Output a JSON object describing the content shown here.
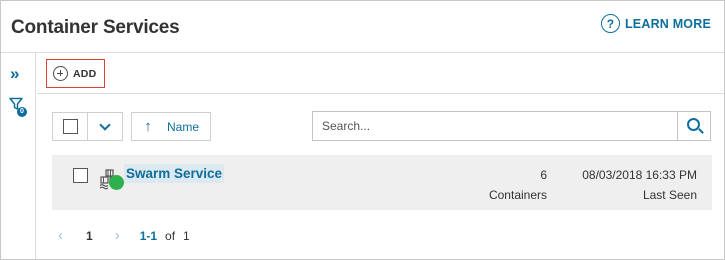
{
  "header": {
    "title": "Container Services",
    "help_glyph": "?",
    "learn_more": "LEARN MORE"
  },
  "sidebar": {
    "expand_glyph": "»",
    "filter_count": "0"
  },
  "toolbar": {
    "add_label": "ADD"
  },
  "list_controls": {
    "sort_arrow": "↑",
    "sort_label": "Name",
    "search_placeholder": "Search..."
  },
  "rows": [
    {
      "name": "Swarm Service",
      "status_color": "#2eb04c",
      "count": "6",
      "count_label": "Containers",
      "last_seen": "08/03/2018 16:33 PM",
      "last_seen_label": "Last Seen"
    }
  ],
  "pagination": {
    "prev": "‹",
    "current_page": "1",
    "next": "›",
    "range": "1-1",
    "of_label": "of",
    "total": "1"
  },
  "colors": {
    "accent": "#0d6e9c",
    "highlight_border": "#d9403a",
    "status_ok": "#2eb04c"
  }
}
